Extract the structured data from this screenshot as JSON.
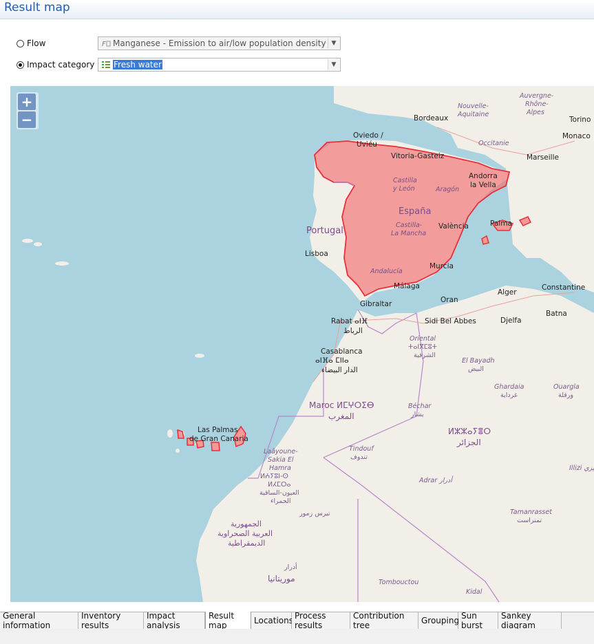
{
  "header": {
    "title": "Result map"
  },
  "selection": {
    "flow": {
      "label": "Flow",
      "value": "Manganese - Emission to air/low population density",
      "checked": false
    },
    "impact": {
      "label": "Impact category",
      "value": "Fresh water",
      "checked": true
    }
  },
  "map": {
    "zoom_in": "+",
    "zoom_out": "−",
    "labels": {
      "bordeaux": "Bordeaux",
      "nouvelle_1": "Nouvelle-",
      "nouvelle_2": "Aquitaine",
      "auvergne_1": "Auvergne-",
      "auvergne_2": "Rhône-",
      "auvergne_3": "Alpes",
      "torino": "Torino",
      "monaco": "Monaco",
      "occitanie": "Occitanie",
      "marseille": "Marseille",
      "oviedo_1": "Oviedo /",
      "oviedo_2": "Uviéu",
      "vitoria": "Vitoria-Gasteiz",
      "andorra_1": "Andorra",
      "andorra_2": "la Vella",
      "castilla_1": "Castilla",
      "castilla_2": "y León",
      "aragon": "Aragón",
      "espana": "España",
      "portugal": "Portugal",
      "clm_1": "Castilla-",
      "clm_2": "La Mancha",
      "valencia": "València",
      "palma": "Palma",
      "lisboa": "Lisboa",
      "murcia": "Murcia",
      "andalucia": "Andalucía",
      "malaga": "Málaga",
      "gibraltar": "Gibraltar",
      "oran": "Oran",
      "alger": "Alger",
      "constantine": "Constantine",
      "batna": "Batna",
      "rabat_1": "Rabat ⴰⵏⴼ",
      "rabat_2": "الرباط",
      "sidi": "Sidi Bel Abbes",
      "djelfa": "Djelfa",
      "casa_1": "Casablanca",
      "casa_2": "ⴰⵏⴼⴰ ⵎⵏⵏⴰ",
      "casa_3": "الدار البيضاء",
      "oriental_1": "Oriental",
      "oriental_2": "ⵜⴰⵏⴳⵎⵓⵜ",
      "oriental_3": "الشرقية",
      "elbayadh_1": "El Bayadh",
      "elbayadh_2": "البيض",
      "ghardaia_1": "Ghardaia",
      "ghardaia_2": "غرداية",
      "ouargla_1": "Ouargla",
      "ouargla_2": "ورقلة",
      "maroc_1": "Maroc ⵍⵎⵖⵔⵉⴱ",
      "maroc_2": "المغرب",
      "bechar_1": "Béchar",
      "bechar_2": "بشار",
      "algerie_1": "ⵍⵣⵣⴰⵢⴻⵔ",
      "algerie_2": "الجزائر",
      "laspalmas_1": "Las Palmas",
      "laspalmas_2": "de Gran Canaria",
      "tindouf_1": "Tindouf",
      "tindouf_2": "تندوف",
      "laayoune_1": "Laâyoune-",
      "laayoune_2": "Sakia El",
      "laayoune_3": "Hamra",
      "laayoune_4": "ⵍⵄⵢⵓⵏ-ⵙ",
      "laayoune_5": "ⵍⵃⵎⵔⴰ",
      "laayoune_6": "العيون-الساقية",
      "laayoune_7": "الحمراء",
      "adrar": "Adrar أدرار",
      "illizi": "Illizi إيليزي",
      "tirs": "تيرس زمور",
      "sahrawi_1": "الجمهورية",
      "sahrawi_2": "العربية الصحراوية",
      "sahrawi_3": "الديمقراطية",
      "tamanrasset_1": "Tamanrasset",
      "tamanrasset_2": "تمنراست",
      "adrar_m": "أدرار",
      "mauritanie": "موريتانيا",
      "tombouctou": "Tombouctou",
      "kidal": "Kidal"
    }
  },
  "tabs": [
    {
      "label": "General information",
      "active": false
    },
    {
      "label": "Inventory results",
      "active": false
    },
    {
      "label": "Impact analysis",
      "active": false
    },
    {
      "label": "Result map",
      "active": true
    },
    {
      "label": "Locations",
      "active": false
    },
    {
      "label": "Process results",
      "active": false
    },
    {
      "label": "Contribution tree",
      "active": false
    },
    {
      "label": "Grouping",
      "active": false
    },
    {
      "label": "Sun burst",
      "active": false
    },
    {
      "label": "Sankey diagram",
      "active": false
    }
  ],
  "colors": {
    "highlight": "#f26a6a",
    "sea": "#aad3df",
    "land": "#f2efe9",
    "accent": "#1f5fae"
  },
  "icons": {
    "flow": "flow-icon",
    "impact": "impact-category-icon"
  }
}
